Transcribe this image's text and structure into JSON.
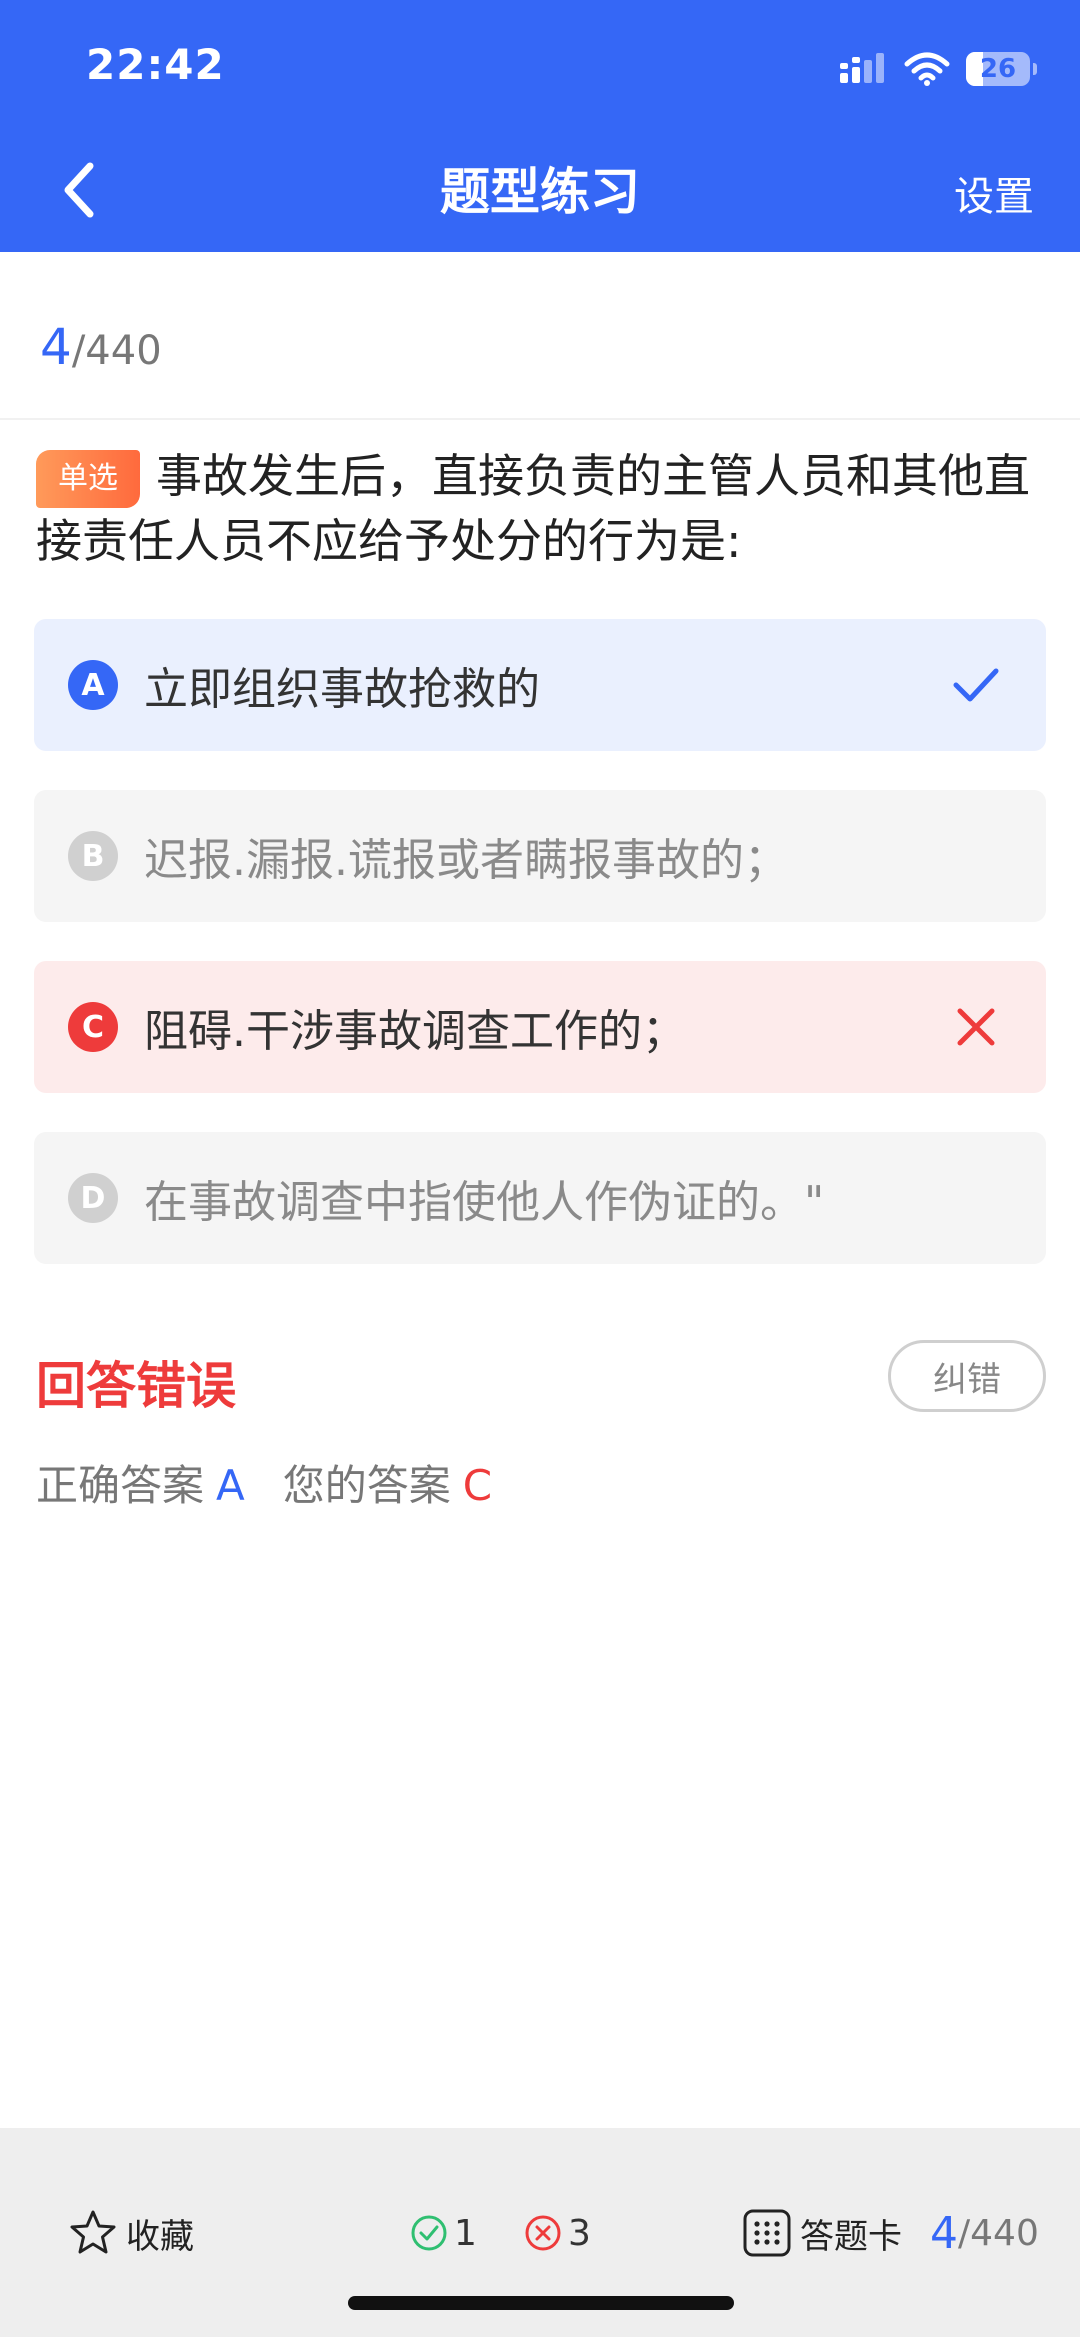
{
  "status_bar": {
    "time": "22:42",
    "battery_text": "26",
    "battery_level": 0.26
  },
  "nav": {
    "title": "题型练习",
    "settings_label": "设置"
  },
  "progress": {
    "current": "4",
    "separator": "/",
    "total": "440"
  },
  "question": {
    "type_badge": "单选",
    "text": "事故发生后，直接负责的主管人员和其他直接责任人员不应给予处分的行为是:"
  },
  "options": [
    {
      "letter": "A",
      "text": "立即组织事故抢救的",
      "state": "correct",
      "mark_icon": "check-icon"
    },
    {
      "letter": "B",
      "text": "迟报.漏报.谎报或者瞒报事故的；",
      "state": "neutral"
    },
    {
      "letter": "C",
      "text": "阻碍.干涉事故调查工作的；",
      "state": "wrong",
      "mark_icon": "cross-icon"
    },
    {
      "letter": "D",
      "text": "在事故调查中指使他人作伪证的。\"",
      "state": "neutral"
    }
  ],
  "result": {
    "title": "回答错误",
    "report_label": "纠错",
    "correct_label": "正确答案",
    "correct_value": "A",
    "your_label": "您的答案",
    "your_value": "C"
  },
  "bottom_bar": {
    "favorite_label": "收藏",
    "right_count": "1",
    "wrong_count": "3",
    "answer_card_label": "答题卡",
    "progress_current": "4",
    "progress_separator": "/",
    "progress_total": "440"
  },
  "colors": {
    "primary": "#3567f6",
    "error": "#ee3b3b",
    "success": "#2fbf71",
    "badge": "#ff7a45"
  }
}
